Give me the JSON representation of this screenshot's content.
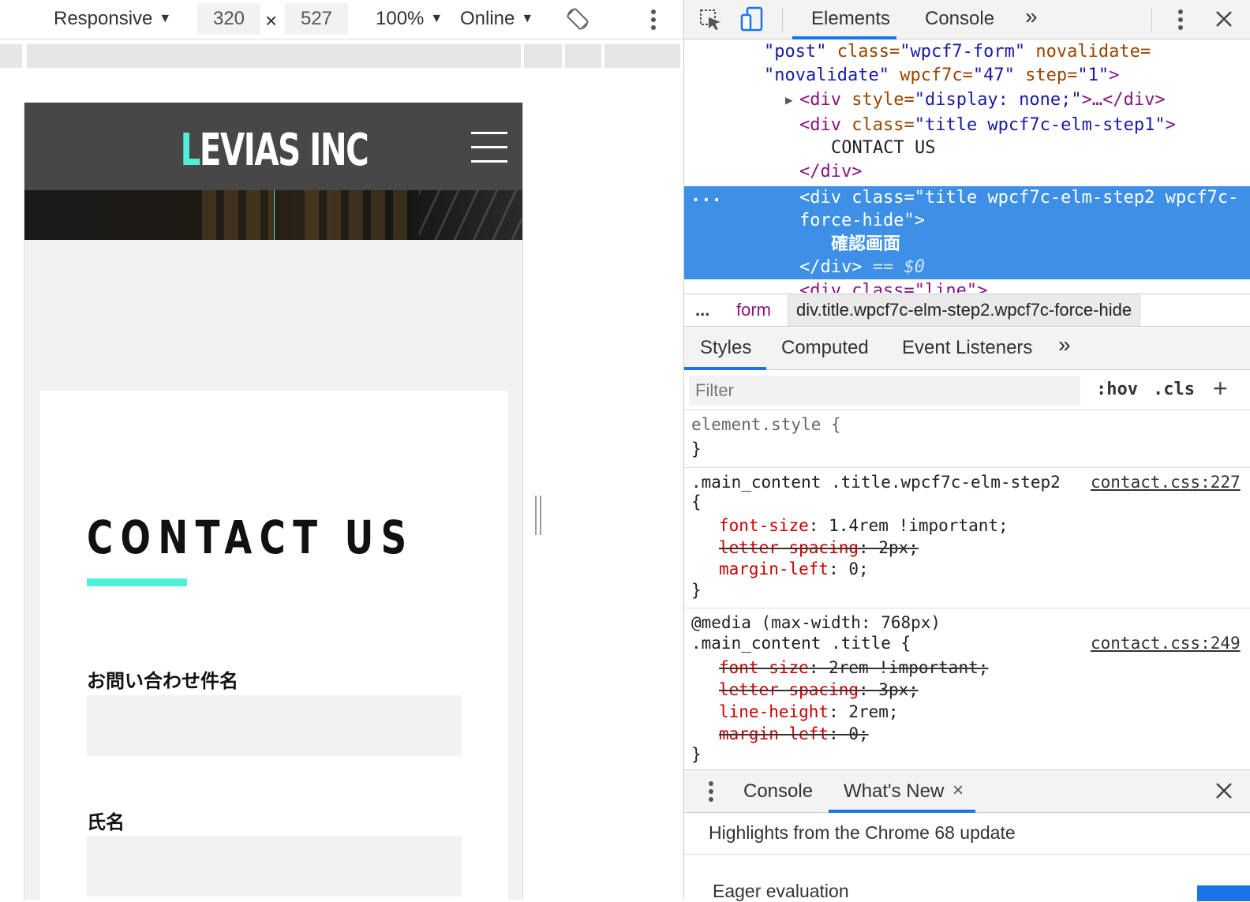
{
  "device_toolbar": {
    "device": "Responsive",
    "width": "320",
    "times": "×",
    "height": "527",
    "zoom": "100%",
    "network": "Online"
  },
  "site": {
    "logo_accent": "L",
    "logo_rest": "EVIAS INC",
    "contact_title": "CONTACT US",
    "field1_label": "お問い合わせ件名",
    "field2_label": "氏名",
    "accent_color": "#4ff0d6"
  },
  "devtools": {
    "tabs": {
      "elements": "Elements",
      "console": "Console",
      "more": "»"
    },
    "code": {
      "l1": {
        "a": "\"post\"",
        "b": " class=",
        "c": "\"wpcf7-form\"",
        "d": " novalidate="
      },
      "l2": {
        "a": "\"novalidate\"",
        "b": " wpcf7c=",
        "c": "\"47\"",
        "d": " step=",
        "e": "\"1\"",
        "f": ">"
      },
      "l3": {
        "a": "<div ",
        "b": "style=",
        "c": "\"display: none;\"",
        "d": ">…</div>"
      },
      "l4": {
        "a": "<div ",
        "b": "class=",
        "c": "\"title wpcf7c-elm-step1\"",
        "d": ">"
      },
      "l5": "CONTACT US",
      "l6": "</div>",
      "sel1": {
        "a": "<div ",
        "b": "class=",
        "c": "\"title wpcf7c-elm-step2 wpcf7c-"
      },
      "sel2": {
        "a": "force-hide\"",
        "b": ">"
      },
      "sel3": "確認画面",
      "sel4": {
        "a": "</div>",
        "b": " == $0"
      },
      "l8": "<div class=\"line\">",
      "ellipsis": "..."
    },
    "breadcrumb": {
      "ellipsis": "...",
      "form": "form",
      "selected": "div.title.wpcf7c-elm-step2.wpcf7c-force-hide"
    },
    "styles_tabs": {
      "styles": "Styles",
      "computed": "Computed",
      "listeners": "Event Listeners",
      "more": "»"
    },
    "filter": {
      "placeholder": "Filter",
      "hov": ":hov",
      "cls": ".cls",
      "plus": "+"
    },
    "rules": {
      "r0": {
        "selector": "element.style {",
        "close": "}"
      },
      "r1": {
        "selector": ".main_content .title.wpcf7c-elm-step2",
        "source": "contact.css:227",
        "open": "{",
        "p1n": "font-size",
        "p1v": ": 1.4rem !important;",
        "p2n": "letter-spacing",
        "p2v": ": 2px;",
        "p3n": "margin-left",
        "p3v": ": 0;",
        "close": "}"
      },
      "r2": {
        "media": "@media (max-width: 768px)",
        "selector": ".main_content .title {",
        "source": "contact.css:249",
        "p1n": "font-size",
        "p1v": ": 2rem !important;",
        "p2n": "letter-spacing",
        "p2v": ": 3px;",
        "p3n": "line-height",
        "p3v": ": 2rem;",
        "p4n": "margin-left",
        "p4v": ": 0;",
        "close": "}"
      }
    },
    "drawer": {
      "console": "Console",
      "whatsnew": "What's New",
      "close_x": "×",
      "heading": "Highlights from the Chrome 68 update",
      "cut_text": "Eager evaluation"
    }
  }
}
